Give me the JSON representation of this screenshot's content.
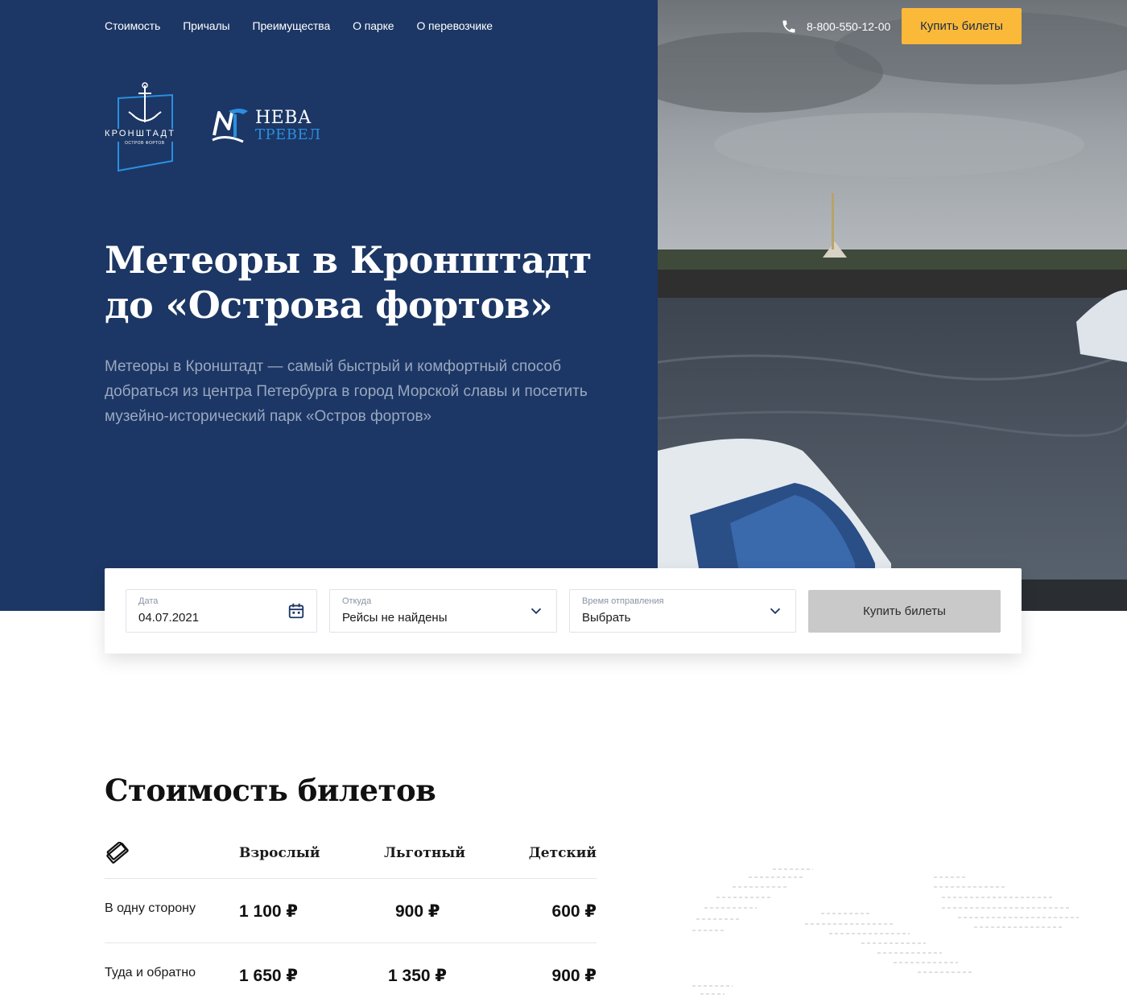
{
  "nav": {
    "items": [
      "Стоимость",
      "Причалы",
      "Преимущества",
      "О парке",
      "О перевозчике"
    ]
  },
  "header": {
    "phone": "8-800-550-12-00",
    "buy_label": "Купить билеты"
  },
  "logos": {
    "kronstadt_text": "КРОНШТАДТ",
    "kronstadt_sub": "ОСТРОВ ФОРТОВ",
    "neva_line1": "НЕВА",
    "neva_line2": "ТРЕВЕЛ"
  },
  "hero": {
    "title": "Метеоры в Кронштадт до «Острова фортов»",
    "description": "Метеоры в Кронштадт — самый быстрый и комфортный способ добраться из центра Петербурга в город Морской славы и посетить музейно-исторический парк «Остров фортов»"
  },
  "booking": {
    "date_label": "Дата",
    "date_value": "04.07.2021",
    "from_label": "Откуда",
    "from_value": "Рейсы не найдены",
    "time_label": "Время отправления",
    "time_value": "Выбрать",
    "buy_label": "Купить билеты"
  },
  "prices": {
    "title": "Стоимость билетов",
    "columns": [
      "Взрослый",
      "Льготный",
      "Детский"
    ],
    "rows": [
      {
        "label": "В одну сторону",
        "values": [
          "1 100 ₽",
          "900 ₽",
          "600 ₽"
        ]
      },
      {
        "label": "Туда и обратно",
        "values": [
          "1 650 ₽",
          "1 350 ₽",
          "900 ₽"
        ]
      }
    ]
  },
  "colors": {
    "hero_bg": "#1c3765",
    "accent": "#fbb93a",
    "logo_blue": "#2b8fe0",
    "disabled_button": "#c9c9c9"
  },
  "icons": [
    "phone-icon",
    "calendar-icon",
    "chevron-down-icon",
    "ticket-icon"
  ]
}
